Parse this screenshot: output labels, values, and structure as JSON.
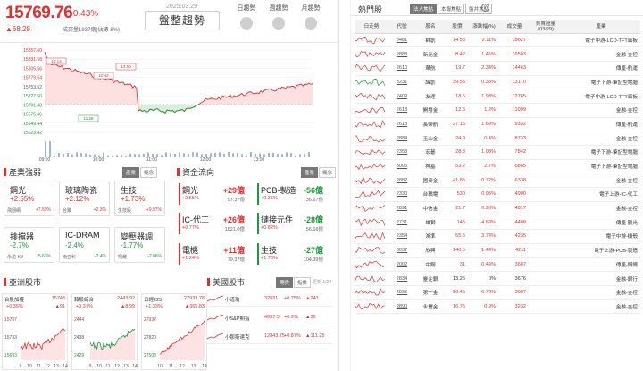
{
  "header": {
    "index_value": "15769.76",
    "index_pct": "+0.43%",
    "index_change": "▲68.28",
    "volume": "成交量1937億(佔總-8%)",
    "date": "2025.03.29",
    "trend_label": "盤整趨勢",
    "toggles": [
      {
        "label": "日趨勢"
      },
      {
        "label": "週趨勢"
      },
      {
        "label": "月趨勢"
      }
    ]
  },
  "main_chart": {
    "y_ticks": [
      "15857.60",
      "15831.58",
      "15805.56",
      "15779.54",
      "15753.52",
      "15727.50",
      "15701.48",
      "15675.46",
      "15649.44",
      "15623.42"
    ],
    "x_ticks": [
      "09:00",
      "11:00",
      "13:00"
    ],
    "x_ticks_mid": [
      "10:00",
      "12:00"
    ],
    "annotations": [
      "10:13",
      "10:42",
      "13:50",
      "11:28"
    ],
    "colors": {
      "up": "#e03030",
      "down": "#1a9a3a",
      "up_fill": "#fde0e0",
      "down_fill": "#d7f0dd"
    }
  },
  "industry": {
    "title": "產業強弱",
    "tabs": [
      "產業",
      "概念"
    ],
    "tiles": [
      {
        "name": "鋼光",
        "pct": "+2.55%",
        "sub_name": "飛翔網",
        "sub_pct": "+7.59%",
        "dir": "up"
      },
      {
        "name": "玻璃陶瓷",
        "pct": "+2.12%",
        "sub_name": "台聚",
        "sub_pct": "+2.3%",
        "dir": "up"
      },
      {
        "name": "生技",
        "pct": "+1.73%",
        "sub_name": "生技股",
        "sub_pct": "+9.97%",
        "dir": "up"
      },
      {
        "name": "排擋器",
        "pct": "-2.7%",
        "sub_name": "永盈-KY",
        "sub_pct": "-5.63%",
        "dir": "down"
      },
      {
        "name": "IC-DRAM",
        "pct": "-2.4%",
        "sub_name": "南亞科",
        "sub_pct": "-2.4%",
        "dir": "down"
      },
      {
        "name": "變壓器調",
        "pct": "-1.77%",
        "sub_name": "翔耀",
        "sub_pct": "-2.06%",
        "dir": "down"
      }
    ]
  },
  "fund_flow": {
    "title": "資金流向",
    "tabs": [
      "產業",
      "概念"
    ],
    "cards": [
      {
        "name": "鋼光",
        "value": "+29億",
        "pct": "+2.55%",
        "total": "97.37億",
        "dir": "up"
      },
      {
        "name": "PCB-製造",
        "value": "-56億",
        "pct": "+0.36%",
        "total": "36.67億",
        "dir": "down"
      },
      {
        "name": "IC-代工",
        "value": "+26億",
        "pct": "+0.77%",
        "total": "1821.0億",
        "dir": "up"
      },
      {
        "name": "鏈接元件",
        "value": "-28億",
        "pct": "+0.82%",
        "total": "56.66億",
        "dir": "down"
      },
      {
        "name": "電機",
        "value": "+11億",
        "pct": "+1.24%",
        "total": "79.37億",
        "dir": "up"
      },
      {
        "name": "生技",
        "value": "-27億",
        "pct": "+1.73%",
        "total": "104.39億",
        "dir": "down"
      }
    ]
  },
  "asia": {
    "title": "亞洲股市",
    "charts": [
      {
        "name": "台股加權",
        "value": "15743",
        "pct": "+0.35%",
        "chg": "▲91",
        "ticks": [
          "15787",
          "15733",
          "15693"
        ],
        "x": [
          "9",
          "10",
          "11",
          "12",
          "13",
          "14"
        ]
      },
      {
        "name": "韓股綜合",
        "value": "2443.92",
        "pct": "+0.37%",
        "chg": "▲8.99",
        "ticks": [
          "2444",
          "2438",
          "2429"
        ],
        "x": [
          "9",
          "10",
          "11",
          "12",
          "13",
          "14"
        ]
      },
      {
        "name": "日經225",
        "value": "27933.78",
        "pct": "+1.33%",
        "chg": "▲365.83",
        "ticks": [
          "27932",
          "27820",
          "27508"
        ],
        "x": [
          "10",
          "11",
          "12",
          "13",
          "14"
        ]
      }
    ]
  },
  "us": {
    "title": "美國股市",
    "tabs": [
      "期貨",
      "指數"
    ],
    "updated": "更新 1/29",
    "rows": [
      {
        "name": "小道瓊",
        "value": "32831",
        "pct": "+0.75%",
        "chg": "▲243"
      },
      {
        "name": "小S&P期指",
        "value": "4037.5",
        "pct": "+0.9%",
        "chg": "▲36"
      },
      {
        "name": "小那斯達克",
        "value": "12843.75",
        "pct": "+0.87%",
        "chg": "▲111.25"
      }
    ]
  },
  "hot": {
    "title": "熱門股",
    "tabs": [
      "法人焦點",
      "本報焦點",
      "盤井焦點"
    ],
    "help": "?",
    "columns": [
      "日走勢",
      "代號",
      "股名",
      "股價",
      "漲跌幅(%)",
      "成交量",
      "買賣超量\n(03/29)",
      "產業"
    ],
    "rows": [
      {
        "code": "3481",
        "name": "群創",
        "price": "14.55",
        "pct": "2.11%",
        "vol": "18627",
        "ind": "電子中游-LCD-TFT面板",
        "dir": "up"
      },
      {
        "code": "2888",
        "name": "新光金",
        "price": "8.42",
        "pct": "1.45%",
        "vol": "16503",
        "ind": "金融-金控",
        "dir": "up"
      },
      {
        "code": "2610",
        "name": "華航",
        "price": "19.7",
        "pct": "2.34%",
        "vol": "14463",
        "ind": "傳產-航運",
        "dir": "up"
      },
      {
        "code": "3231",
        "name": "緯創",
        "price": "39.55",
        "pct": "0.38%",
        "vol": "13170",
        "ind": "電子下游-筆記型電腦",
        "dir": "green"
      },
      {
        "code": "2409",
        "name": "友達",
        "price": "18.5",
        "pct": "1.93%",
        "vol": "12765",
        "ind": "電子中游-LCD-TFT面板",
        "dir": "up"
      },
      {
        "code": "2618",
        "name": "開發金",
        "price": "12.6",
        "pct": "1.2%",
        "vol": "11099",
        "ind": "金融-金控",
        "dir": "up"
      },
      {
        "code": "2618",
        "name": "長榮航",
        "price": "27.15",
        "pct": "1.69%",
        "vol": "9332",
        "ind": "傳產-航運",
        "dir": "up"
      },
      {
        "code": "2884",
        "name": "玉山金",
        "price": "24.9",
        "pct": "0.4%",
        "vol": "8733",
        "ind": "金融-金控",
        "dir": "up"
      },
      {
        "code": "2353",
        "name": "宏碁",
        "price": "28.3",
        "pct": "1.08%",
        "vol": "7842",
        "ind": "電子下游-筆記型電腦",
        "dir": "up"
      },
      {
        "code": "3005",
        "name": "神基",
        "price": "53.2",
        "pct": "2.7%",
        "vol": "6865",
        "ind": "電子下游-筆記型電腦",
        "dir": "up"
      },
      {
        "code": "2882",
        "name": "國泰金",
        "price": "41.85",
        "pct": "0.72%",
        "vol": "6338",
        "ind": "金融-金控",
        "dir": "up"
      },
      {
        "code": "2330",
        "name": "台積電",
        "price": "530",
        "pct": "0.95%",
        "vol": "4900",
        "ind": "電子上游-IC-代工",
        "dir": "up"
      },
      {
        "code": "2891",
        "name": "中信金",
        "price": "21.7",
        "pct": "0.93%",
        "vol": "4817",
        "ind": "金融-金控",
        "dir": "up"
      },
      {
        "code": "2731",
        "name": "雄獅",
        "price": "145",
        "pct": "4.69%",
        "vol": "4488",
        "ind": "傳產-觀光",
        "dir": "up"
      },
      {
        "code": "2354",
        "name": "鴻準",
        "price": "55.5",
        "pct": "3.74%",
        "vol": "4235",
        "ind": "電子中游-機殼",
        "dir": "up"
      },
      {
        "code": "3037",
        "name": "欣興",
        "price": "140.5",
        "pct": "1.44%",
        "vol": "4211",
        "ind": "電子上游-PCB-製造",
        "dir": "up"
      },
      {
        "code": "2002",
        "name": "中鋼",
        "price": "31",
        "pct": "0.49%",
        "vol": "3687",
        "ind": "傳產-鋼鐵",
        "dir": "up"
      },
      {
        "code": "2834",
        "name": "臺企銀",
        "price": "13.25",
        "pct": "0%",
        "vol": "3676",
        "ind": "金融-銀行",
        "dir": "flat"
      },
      {
        "code": "2892",
        "name": "第一金",
        "price": "26.45",
        "pct": "0.76%",
        "vol": "3667",
        "ind": "金融-金控",
        "dir": "up"
      },
      {
        "code": "2890",
        "name": "永豐金",
        "price": "16.75",
        "pct": "0.9%",
        "vol": "3232",
        "ind": "金融-金控",
        "dir": "up"
      }
    ]
  }
}
